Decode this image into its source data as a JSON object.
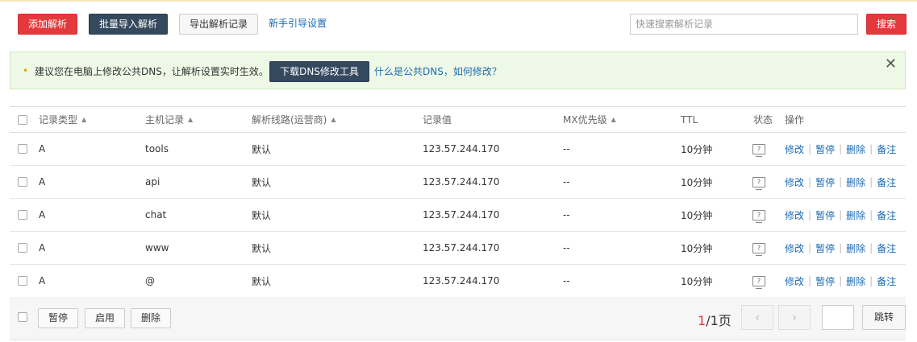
{
  "toolbar": {
    "add_label": "添加解析",
    "import_label": "批量导入解析",
    "export_label": "导出解析记录",
    "guide_label": "新手引导设置",
    "search_placeholder": "快速搜索解析记录",
    "search_label": "搜索"
  },
  "notice": {
    "text": "建议您在电脑上修改公共DNS，让解析设置实时生效。",
    "download_label": "下载DNS修改工具",
    "link_text": "什么是公共DNS，如何修改？",
    "close_glyph": "✕"
  },
  "table": {
    "headers": {
      "type": "记录类型",
      "host": "主机记录",
      "line": "解析线路(运营商)",
      "value": "记录值",
      "mx": "MX优先级",
      "ttl": "TTL",
      "status": "状态",
      "ops": "操作"
    },
    "sort_glyph": "▲",
    "status_glyph": "?",
    "ops": {
      "edit": "修改",
      "pause": "暂停",
      "delete": "删除",
      "note": "备注",
      "sep": "|"
    },
    "rows": [
      {
        "type": "A",
        "host": "tools",
        "line": "默认",
        "value": "123.57.244.170",
        "mx": "--",
        "ttl": "10分钟"
      },
      {
        "type": "A",
        "host": "api",
        "line": "默认",
        "value": "123.57.244.170",
        "mx": "--",
        "ttl": "10分钟"
      },
      {
        "type": "A",
        "host": "chat",
        "line": "默认",
        "value": "123.57.244.170",
        "mx": "--",
        "ttl": "10分钟"
      },
      {
        "type": "A",
        "host": "www",
        "line": "默认",
        "value": "123.57.244.170",
        "mx": "--",
        "ttl": "10分钟"
      },
      {
        "type": "A",
        "host": "@",
        "line": "默认",
        "value": "123.57.244.170",
        "mx": "--",
        "ttl": "10分钟"
      }
    ]
  },
  "footer": {
    "pause_label": "暂停",
    "enable_label": "启用",
    "delete_label": "删除",
    "current_page": "1",
    "total_pages": "/1页",
    "prev_glyph": "‹",
    "next_glyph": "›",
    "jump_label": "跳转"
  },
  "colors": {
    "primary_red": "#e4393c",
    "dark_button": "#34495e",
    "link_blue": "#1a6bb5",
    "notice_bg": "#eef8e6"
  },
  "icons": {
    "close": "close-icon",
    "sort": "sort-up-icon",
    "status": "status-help-icon",
    "prev": "chevron-left-icon",
    "next": "chevron-right-icon"
  }
}
